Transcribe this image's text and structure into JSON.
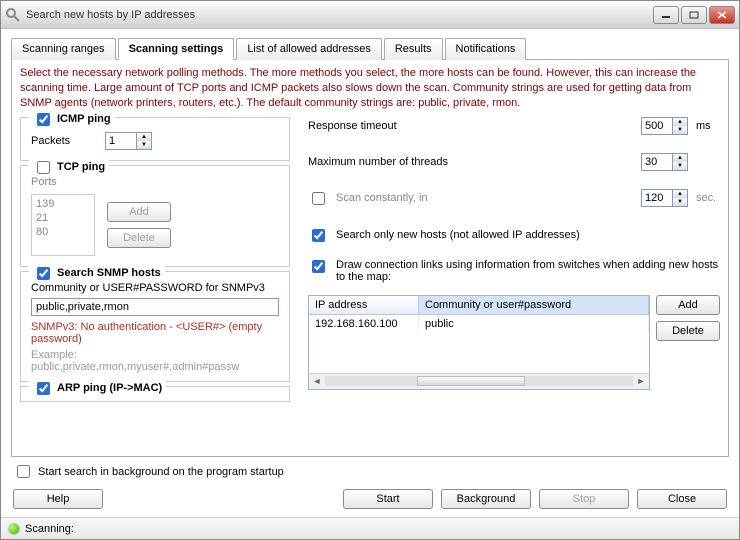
{
  "window": {
    "title": "Search new hosts by IP addresses"
  },
  "tabs": {
    "t0": "Scanning ranges",
    "t1": "Scanning settings",
    "t2": "List of allowed addresses",
    "t3": "Results",
    "t4": "Notifications"
  },
  "instruction": "Select the necessary network polling methods. The more methods you select, the more hosts can be found. However, this can increase the scanning time. Large amount of TCP ports and ICMP packets also slows down the scan. Community strings are used for getting data from SNMP agents (network printers, routers, etc.). The default community strings are: public, private, rmon.",
  "icmp": {
    "legend": "ICMP ping",
    "packets_label": "Packets",
    "packets": "1"
  },
  "tcp": {
    "legend": "TCP ping",
    "ports_label": "Ports",
    "ports": [
      "139",
      "21",
      "80"
    ],
    "add": "Add",
    "del": "Delete"
  },
  "snmp": {
    "legend": "Search SNMP hosts",
    "community_label": "Community or USER#PASSWORD for SNMPv3",
    "value": "public,private,rmon",
    "note": "SNMPv3: No authentication - <USER#> (empty password)",
    "example": "Example: public,private,rmon,myuser#,admin#passw"
  },
  "arp": {
    "legend": "ARP ping (IP->MAC)"
  },
  "right": {
    "resp_label": "Response timeout",
    "resp_val": "500",
    "resp_unit": "ms",
    "threads_label": "Maximum number of threads",
    "threads_val": "30",
    "scan_const_label": "Scan constantly, in",
    "scan_const_val": "120",
    "scan_const_unit": "sec.",
    "only_new": "Search only new hosts (not allowed IP addresses)",
    "draw_links": "Draw connection links using information from switches when adding new hosts to the map:",
    "table": {
      "col1": "IP address",
      "col2": "Community or user#password",
      "r1c1": "192.168.160.100",
      "r1c2": "public",
      "add": "Add",
      "del": "Delete"
    }
  },
  "startup": "Start search in background on the program startup",
  "buttons": {
    "help": "Help",
    "start": "Start",
    "bg": "Background",
    "stop": "Stop",
    "close": "Close"
  },
  "status": "Scanning:"
}
